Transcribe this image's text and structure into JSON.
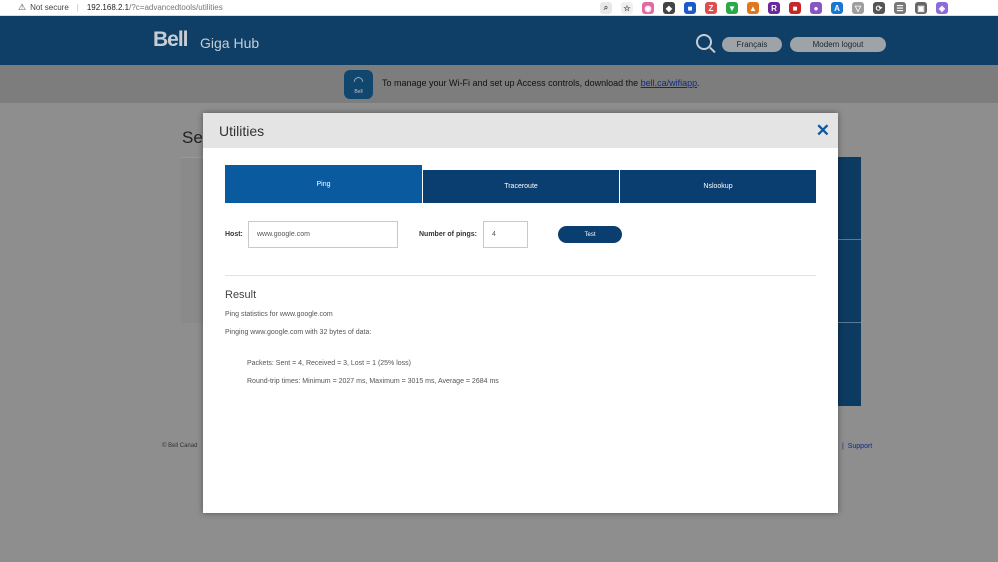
{
  "browser": {
    "security_label": "Not secure",
    "url_host": "192.168.2.1",
    "url_path": "/?c=advancedtools/utilities",
    "extensions": [
      {
        "color": "#e8e8e8",
        "glyph": "⌕"
      },
      {
        "color": "#f0f0f0",
        "glyph": "☆"
      },
      {
        "color": "#e46aa5",
        "glyph": "◉"
      },
      {
        "color": "#444444",
        "glyph": "◆"
      },
      {
        "color": "#1c5ac9",
        "glyph": "■"
      },
      {
        "color": "#e04b4b",
        "glyph": "Z"
      },
      {
        "color": "#2aa84a",
        "glyph": "▼"
      },
      {
        "color": "#e2761b",
        "glyph": "▲"
      },
      {
        "color": "#6a2a9b",
        "glyph": "R"
      },
      {
        "color": "#c62828",
        "glyph": "■"
      },
      {
        "color": "#8a55c2",
        "glyph": "●"
      },
      {
        "color": "#1976d2",
        "glyph": "A"
      },
      {
        "color": "#9e9e9e",
        "glyph": "▽"
      },
      {
        "color": "#555555",
        "glyph": "⟳"
      },
      {
        "color": "#777777",
        "glyph": "☰"
      },
      {
        "color": "#666666",
        "glyph": "▣"
      },
      {
        "color": "#8d6ad9",
        "glyph": "◈"
      }
    ]
  },
  "header": {
    "logo": "Bell",
    "product": "Giga Hub",
    "language_button": "Français",
    "logout_button": "Modem logout"
  },
  "banner": {
    "icon_label": "Bell",
    "text": "To manage your Wi-Fi and set up Access controls, download the ",
    "link": "bell.ca/wifiapp",
    "suffix": "."
  },
  "background": {
    "heading": "Se",
    "footer_left": "© Bell Canad",
    "footer_sep": "|",
    "support_link": "Support"
  },
  "modal": {
    "title": "Utilities",
    "close_glyph": "✕",
    "tabs": [
      {
        "label": "Ping",
        "active": true
      },
      {
        "label": "Traceroute",
        "active": false
      },
      {
        "label": "Nslookup",
        "active": false
      }
    ],
    "host_label": "Host:",
    "host_value": "www.google.com",
    "pings_label": "Number of pings:",
    "pings_value": "4",
    "test_button": "Test",
    "result_title": "Result",
    "result_lines": [
      "Ping statistics for www.google.com",
      "Pinging www.google.com with 32 bytes of data:",
      "Packets: Sent = 4, Received = 3, Lost = 1 (25% loss)",
      "Round-trip times: Minimum = 2027 ms, Maximum = 3015 ms, Average = 2684 ms"
    ]
  }
}
